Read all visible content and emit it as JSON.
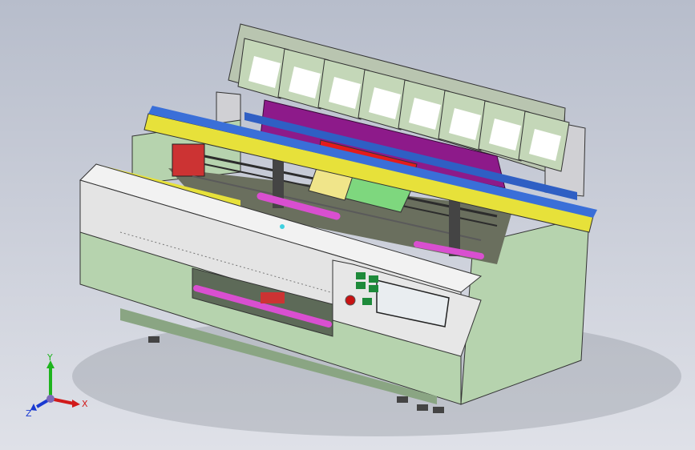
{
  "viewport": {
    "background_top": "#b7bdcb",
    "background_bottom": "#dfe1e8"
  },
  "model": {
    "frame_color": "#b6d3ae",
    "cover_color": "#e4e4e4",
    "bin_color": "#c4d7b8",
    "rail_yellow": "#e7e13a",
    "rail_blue": "#3a6fd8",
    "red_block": "#e31b1b",
    "purple_panel": "#8d1a8a",
    "magenta_rod": "#d94fd0",
    "panel_buttons_color": "#1e8a3a",
    "emergency_stop_color": "#c81212",
    "bin_count": 8
  },
  "triad": {
    "x_label": "X",
    "y_label": "Y",
    "z_label": "Z",
    "x_color": "#d11a1a",
    "y_color": "#1eb41e",
    "z_color": "#1a3ad1"
  }
}
